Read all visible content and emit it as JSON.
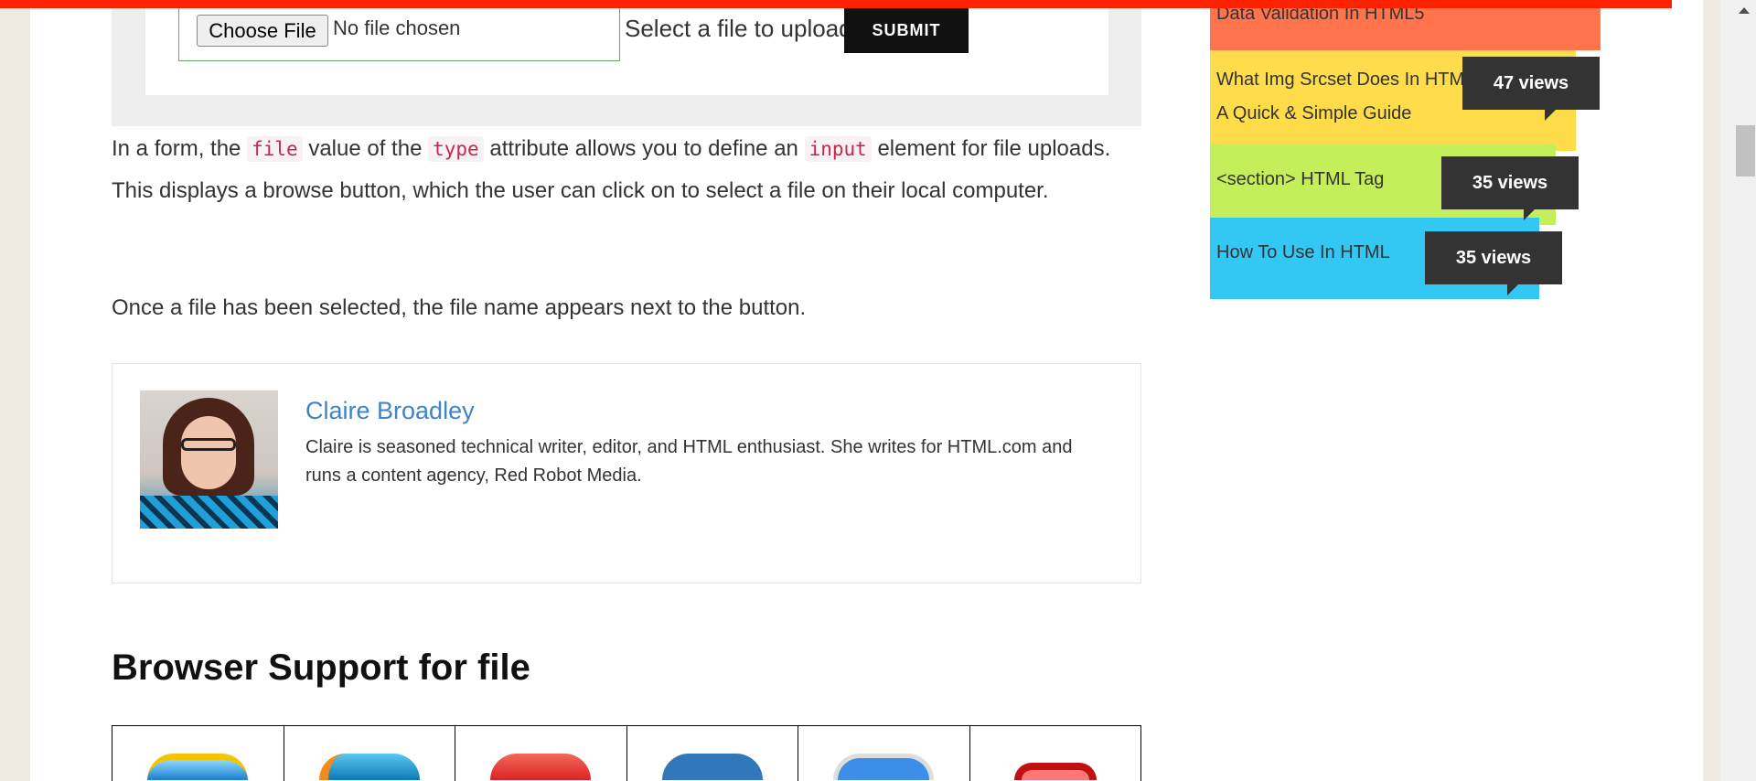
{
  "demo": {
    "choose_file": "Choose File",
    "no_file": "No file chosen",
    "select_label": "Select a file to upload",
    "submit": "SUBMIT"
  },
  "article": {
    "p1": {
      "a": "In a form, the ",
      "code1": "file",
      "b": " value of the ",
      "code2": "type",
      "c": " attribute allows you to define an ",
      "code3": "input",
      "d": " element for file uploads. This displays a browse button, which the user can click on to select a file on their local computer."
    },
    "p2": "Once a file has been selected, the file name appears next to the button.",
    "author": {
      "name": "Claire Broadley",
      "bio": "Claire is seasoned technical writer, editor, and HTML enthusiast. She writes for HTML.com and runs a content agency, Red Robot Media."
    },
    "browser_heading": "Browser Support for file",
    "browsers": [
      "internet-explorer",
      "firefox",
      "chrome",
      "edge",
      "safari",
      "opera"
    ]
  },
  "sidebar": {
    "items": [
      {
        "title": "Data Validation In HTML5",
        "views": "",
        "color": "#ff744d"
      },
      {
        "title": "What Img Srcset Does In HTML5: A Quick & Simple Guide",
        "line1": "What Img Srcset Does In HTML5:",
        "line2": "A Quick & Simple Guide",
        "views": "47 views",
        "color": "#ffdd4a"
      },
      {
        "title": "<section> HTML Tag",
        "views": "35 views",
        "color": "#c5ef5a"
      },
      {
        "title": "How To Use In HTML",
        "views": "35 views",
        "color": "#33c8f4"
      }
    ]
  }
}
